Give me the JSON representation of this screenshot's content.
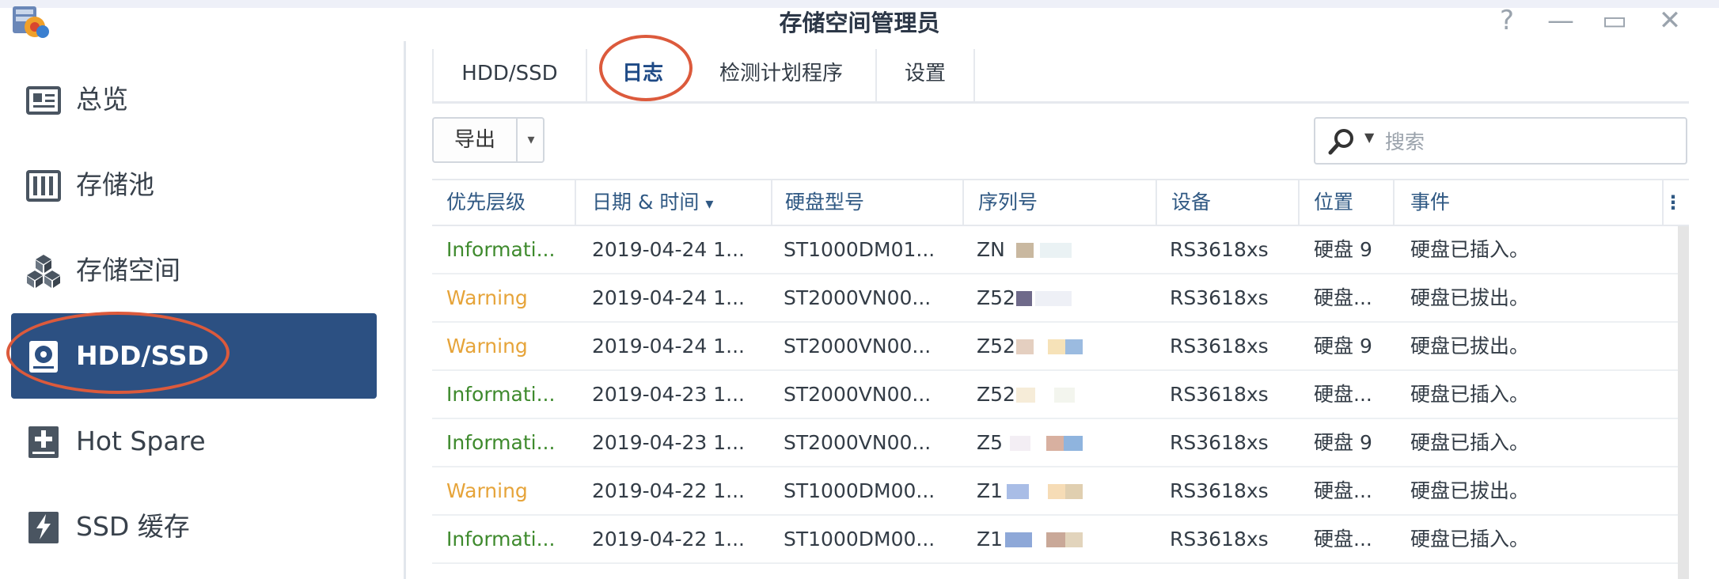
{
  "window": {
    "title": "存储空间管理员",
    "controls": {
      "help": "?",
      "minimize": "—",
      "maximize": "▭",
      "close": "✕"
    }
  },
  "sidebar": {
    "items": [
      {
        "label": "总览",
        "icon": "overview-icon"
      },
      {
        "label": "存储池",
        "icon": "storage-pool-icon"
      },
      {
        "label": "存储空间",
        "icon": "volume-icon"
      },
      {
        "label": "HDD/SSD",
        "icon": "hdd-icon",
        "active": true
      },
      {
        "label": "Hot Spare",
        "icon": "hot-spare-icon"
      },
      {
        "label": "SSD 缓存",
        "icon": "ssd-cache-icon"
      }
    ]
  },
  "tabs": [
    {
      "label": "HDD/SSD"
    },
    {
      "label": "日志",
      "active": true
    },
    {
      "label": "检测计划程序"
    },
    {
      "label": "设置"
    }
  ],
  "toolbar": {
    "export_label": "导出",
    "search_placeholder": "搜索"
  },
  "table": {
    "columns": [
      "优先层级",
      "日期 & 时间",
      "硬盘型号",
      "序列号",
      "设备",
      "位置",
      "事件"
    ],
    "sort_indicator": "▾",
    "rows": [
      {
        "priority": "Informati...",
        "level": "info",
        "datetime": "2019-04-24 1...",
        "model": "ST1000DM01...",
        "serial": "ZN",
        "device": "RS3618xs",
        "location": "硬盘 9",
        "event": "硬盘已插入。"
      },
      {
        "priority": "Warning",
        "level": "warn",
        "datetime": "2019-04-24 1...",
        "model": "ST2000VN00...",
        "serial": "Z52",
        "device": "RS3618xs",
        "location": "硬盘...",
        "event": "硬盘已拔出。"
      },
      {
        "priority": "Warning",
        "level": "warn",
        "datetime": "2019-04-24 1...",
        "model": "ST2000VN00...",
        "serial": "Z52",
        "device": "RS3618xs",
        "location": "硬盘 9",
        "event": "硬盘已拔出。"
      },
      {
        "priority": "Informati...",
        "level": "info",
        "datetime": "2019-04-23 1...",
        "model": "ST2000VN00...",
        "serial": "Z52",
        "device": "RS3618xs",
        "location": "硬盘...",
        "event": "硬盘已插入。"
      },
      {
        "priority": "Informati...",
        "level": "info",
        "datetime": "2019-04-23 1...",
        "model": "ST2000VN00...",
        "serial": "Z5",
        "device": "RS3618xs",
        "location": "硬盘 9",
        "event": "硬盘已插入。"
      },
      {
        "priority": "Warning",
        "level": "warn",
        "datetime": "2019-04-22 1...",
        "model": "ST1000DM00...",
        "serial": "Z1",
        "device": "RS3618xs",
        "location": "硬盘...",
        "event": "硬盘已拔出。"
      },
      {
        "priority": "Informati...",
        "level": "info",
        "datetime": "2019-04-22 1...",
        "model": "ST1000DM00...",
        "serial": "Z1",
        "device": "RS3618xs",
        "location": "硬盘...",
        "event": "硬盘已插入。"
      }
    ]
  },
  "colors": {
    "accent": "#2c5082",
    "info": "#3e8a2d",
    "warning": "#e6a43a",
    "highlight_circle": "#dc5a3c"
  }
}
